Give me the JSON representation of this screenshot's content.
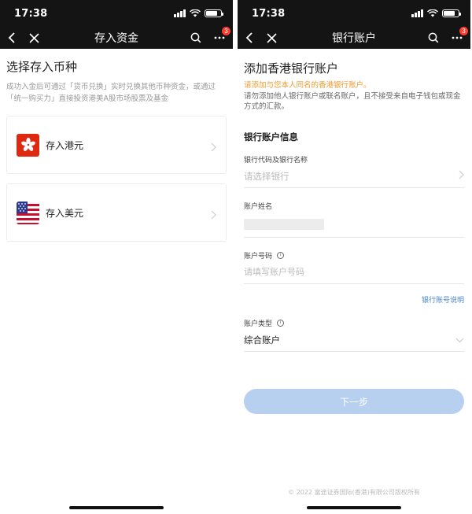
{
  "status": {
    "time": "17:38"
  },
  "left": {
    "nav_title": "存入资金",
    "badge_count": "3",
    "heading": "选择存入币种",
    "description": "成功入金后可通过「货币兑换」实时兑换其他币种资金，或通过「统一购买力」直接投资港美A股市场股票及基金",
    "currencies": [
      {
        "label": "存入港元",
        "icon": "hong-kong-flag-icon"
      },
      {
        "label": "存入美元",
        "icon": "us-flag-icon"
      }
    ]
  },
  "right": {
    "nav_title": "银行账户",
    "badge_count": "3",
    "heading": "添加香港银行账户",
    "warning": "请添加与您本人同名的香港银行账户。",
    "note": "请勿添加他人银行账户或联名账户，且不接受来自电子钱包或现金方式的汇款。",
    "section_title": "银行账户信息",
    "bank_label": "银行代码及银行名称",
    "bank_placeholder": "请选择银行",
    "name_label": "账户姓名",
    "number_label": "账户号码",
    "number_placeholder": "请填写账户号码",
    "number_help_link": "银行账号说明",
    "type_label": "账户类型",
    "type_value": "综合账户",
    "next_button": "下一步",
    "footer": "© 2022 富途证券国际(香港)有限公司版权所有"
  },
  "colors": {
    "header_bg": "#141414",
    "warning": "#f09a2c",
    "link": "#4a86c5",
    "button_disabled": "#b8d0ef",
    "badge": "#ff3b30"
  }
}
